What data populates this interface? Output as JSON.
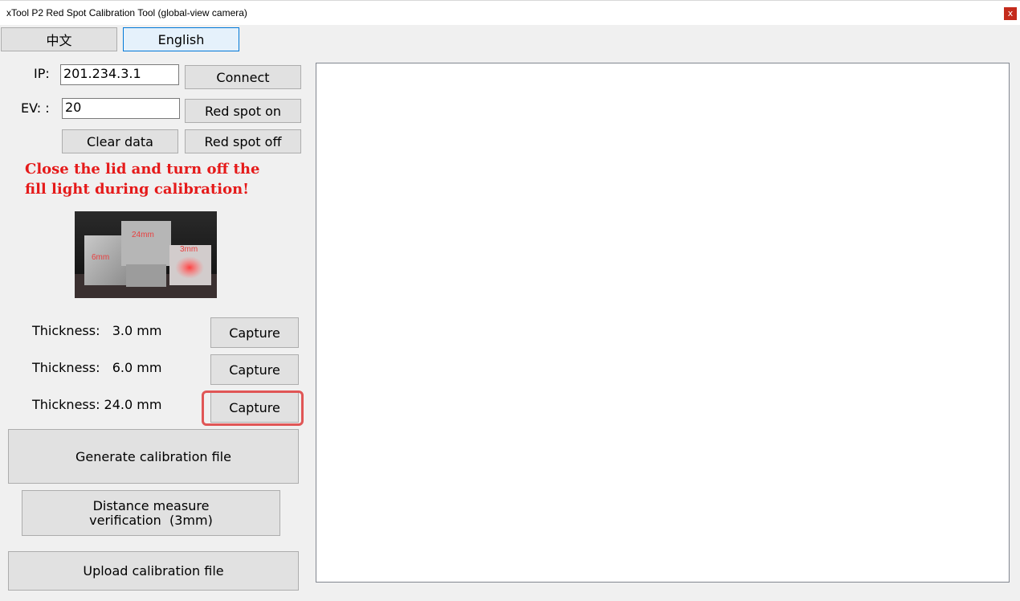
{
  "window": {
    "title": "xTool P2 Red Spot Calibration Tool (global-view camera)",
    "close_glyph": "x"
  },
  "language": {
    "chinese_label": "中文",
    "english_label": "English",
    "selected": "English"
  },
  "connection": {
    "ip_label": "IP:",
    "ip_value": "201.234.3.1",
    "connect_label": "Connect",
    "ev_label": "EV: :",
    "ev_value": "20",
    "red_spot_on_label": "Red spot on",
    "clear_data_label": "Clear data",
    "red_spot_off_label": "Red spot off"
  },
  "warning": {
    "line1": "Close the lid and turn off the",
    "line2": "fill light during calibration!",
    "color": "#e51a1a"
  },
  "photo": {
    "label_24mm": "24mm",
    "label_6mm": "6mm",
    "label_3mm": "3mm"
  },
  "thickness_rows": [
    {
      "label": "Thickness:   3.0 mm",
      "button": "Capture"
    },
    {
      "label": "Thickness:   6.0 mm",
      "button": "Capture"
    },
    {
      "label": "Thickness: 24.0 mm",
      "button": "Capture"
    }
  ],
  "actions": {
    "generate_label": "Generate calibration file",
    "distance_line1": "Distance measure",
    "distance_line2": "verification  (3mm)",
    "upload_label": "Upload calibration file"
  },
  "colors": {
    "highlight": "#e05656",
    "accent": "#0078d7"
  }
}
